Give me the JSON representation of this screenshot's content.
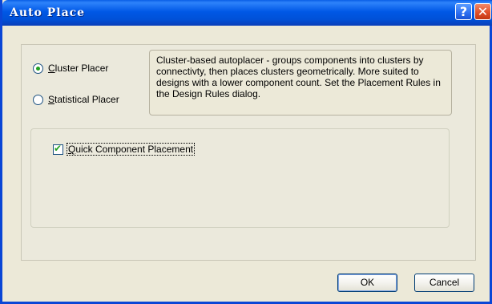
{
  "window": {
    "title": "Auto Place"
  },
  "titlebar": {
    "help_label": "?",
    "close_label": "✕"
  },
  "placer_options": [
    {
      "label": "Cluster Placer",
      "mnemonic": "C",
      "rest": "luster Placer",
      "selected": true
    },
    {
      "label": "Statistical Placer",
      "mnemonic": "S",
      "rest": "tatistical Placer",
      "selected": false
    }
  ],
  "description": "Cluster-based autoplacer - groups components into clusters by connectivty, then places  clusters geometrically. More suited to designs with a lower component count. Set the Placement Rules in the Design Rules dialog.",
  "quick_placement": {
    "label": "Quick Component Placement",
    "mnemonic": "Q",
    "rest": "uick Component Placement",
    "checked": true
  },
  "buttons": {
    "ok": "OK",
    "cancel": "Cancel"
  },
  "colors": {
    "titlebar": "#0058e6",
    "accent_check": "#21a121",
    "dialog_bg": "#ece9d8"
  }
}
